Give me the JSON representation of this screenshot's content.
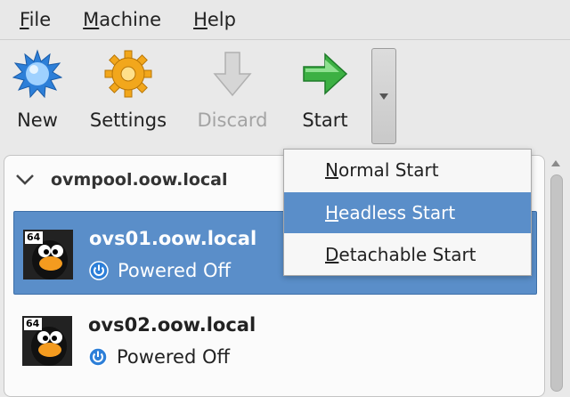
{
  "menubar": {
    "items": [
      {
        "mnemonic": "F",
        "rest": "ile"
      },
      {
        "mnemonic": "M",
        "rest": "achine"
      },
      {
        "mnemonic": "H",
        "rest": "elp"
      }
    ]
  },
  "toolbar": {
    "new_label": "New",
    "settings_label": "Settings",
    "discard_label": "Discard",
    "start_label": "Start",
    "new_icon": "starburst-icon",
    "settings_icon": "gear-icon",
    "discard_icon": "down-arrow-icon",
    "start_icon": "right-arrow-icon"
  },
  "group": {
    "name": "ovmpool.oow.local"
  },
  "vms": [
    {
      "name": "ovs01.oow.local",
      "status": "Powered Off",
      "selected": true,
      "logo_badge": "64"
    },
    {
      "name": "ovs02.oow.local",
      "status": "Powered Off",
      "selected": false,
      "logo_badge": "64"
    }
  ],
  "start_menu": {
    "items": [
      {
        "mnemonic": "N",
        "rest": "ormal Start",
        "highlighted": false
      },
      {
        "mnemonic": "H",
        "rest": "eadless Start",
        "highlighted": true
      },
      {
        "mnemonic": "D",
        "rest": "etachable Start",
        "highlighted": false
      }
    ]
  },
  "colors": {
    "selection": "#5a8ec9",
    "start_arrow": "#3cb043",
    "new_icon": "#3a8fe0",
    "settings_icon": "#f2a71c"
  }
}
